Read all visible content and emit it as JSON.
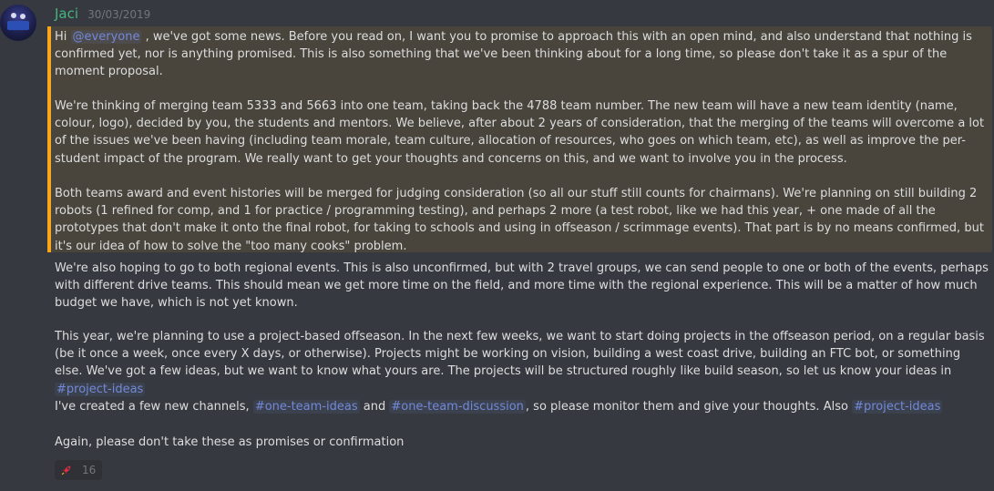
{
  "message": {
    "username": "Jaci",
    "timestamp": "30/03/2019",
    "p1_hi": "Hi ",
    "p1_mention": "@everyone",
    "p1_rest": " , we've got some news. Before you read on, I want you to promise to approach this with an open mind, and also understand that nothing is confirmed yet, nor is anything promised. This is also something that we've been thinking about for a long time, so please don't take it as a spur of the moment proposal.",
    "p2": "We're thinking of merging team 5333 and 5663 into one team, taking back the 4788 team number. The new team will have a new team identity (name, colour, logo), decided by you, the students and mentors. We believe, after about 2 years of consideration, that the merging of the teams will overcome a lot of the issues we've been having (including team morale, team culture, allocation of resources, who goes on which team, etc), as well as improve the per-student impact of the program. We really want to get your thoughts and concerns on this, and we want to involve you in the process.",
    "p3": "Both teams award and event histories will be merged for judging consideration (so all our stuff still counts for chairmans). We're planning on still building 2 robots (1 refined for comp, and 1 for practice / programming testing), and perhaps 2 more (a test robot, like we had this year, + one made of all the prototypes that don't make it onto the final robot, for taking to schools and using in offseason / scrimmage events). That part is by no means confirmed, but it's our idea of how to solve the \"too many cooks\" problem.",
    "p4": "We're also hoping to go to both regional events. This is also unconfirmed, but with 2 travel groups, we can send people to one or both of the events, perhaps with different drive teams. This should mean we get more time on the field, and more time with the regional experience. This will be a matter of how much budget we have, which is not yet known.",
    "p5_text": "This year, we're planning to use a project-based offseason. In the next few weeks, we want to start doing projects in the offseason period, on a regular basis (be it once a week, once every X days, or otherwise). Projects might be working on vision, building a west coast drive, building an FTC bot, or something else. We've got a few ideas, but we want to know what yours are. The projects will be structured roughly like build season, so let us know your ideas in ",
    "p5_channel": "#project-ideas",
    "p6_a": "I've created a few new channels, ",
    "p6_ch1": "#one-team-ideas",
    "p6_b": " and ",
    "p6_ch2": "#one-team-discussion",
    "p6_c": ", so please monitor them and give your thoughts. Also ",
    "p6_ch3": "#project-ideas",
    "p7": "Again, please don't take these as promises or confirmation"
  },
  "reaction": {
    "icon": "rocket-icon",
    "count": "16"
  },
  "colors": {
    "username": "#43b581",
    "mention_bar": "#faa61a",
    "mention_bg": "#49443c",
    "link": "#7289da",
    "background": "#36393f"
  }
}
